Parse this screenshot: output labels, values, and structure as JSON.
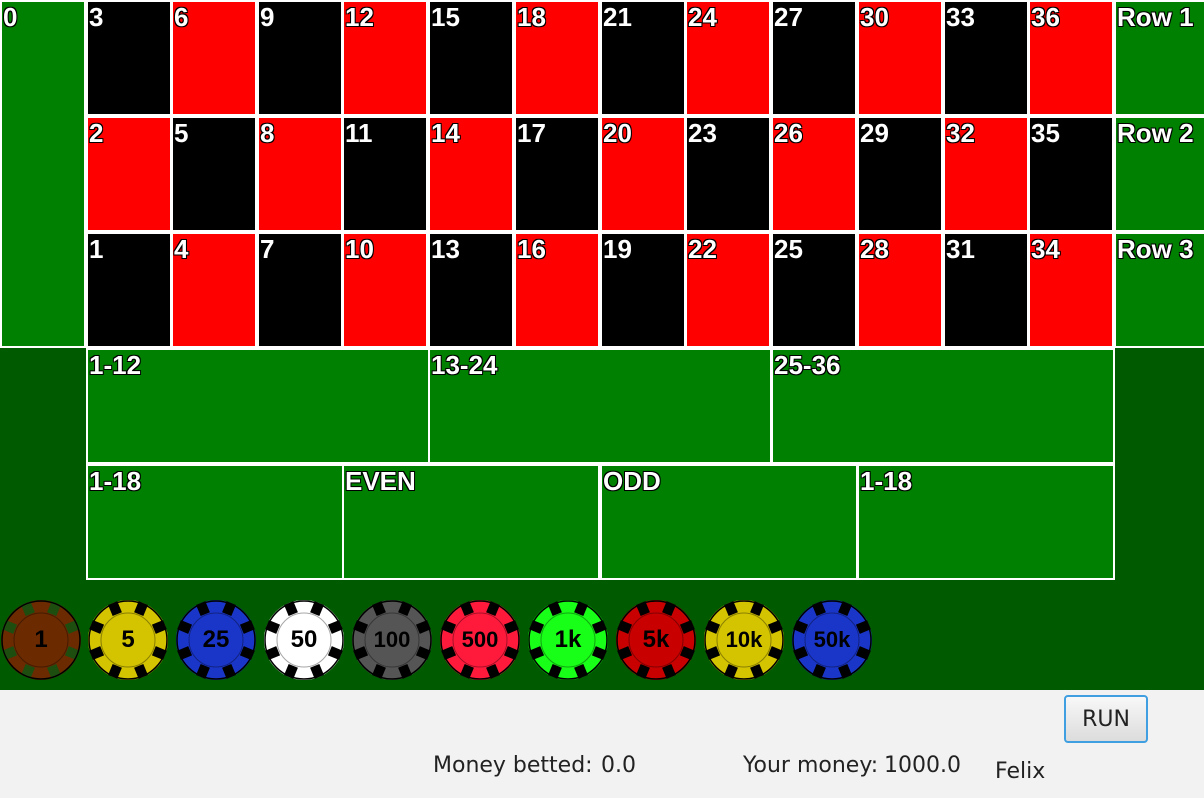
{
  "zero": {
    "label": "0"
  },
  "numbers": [
    {
      "label": "3",
      "color": "black"
    },
    {
      "label": "6",
      "color": "red"
    },
    {
      "label": "9",
      "color": "black"
    },
    {
      "label": "12",
      "color": "red"
    },
    {
      "label": "15",
      "color": "black"
    },
    {
      "label": "18",
      "color": "red"
    },
    {
      "label": "21",
      "color": "black"
    },
    {
      "label": "24",
      "color": "red"
    },
    {
      "label": "27",
      "color": "black"
    },
    {
      "label": "30",
      "color": "red"
    },
    {
      "label": "33",
      "color": "black"
    },
    {
      "label": "36",
      "color": "red"
    },
    {
      "label": "2",
      "color": "red"
    },
    {
      "label": "5",
      "color": "black"
    },
    {
      "label": "8",
      "color": "red"
    },
    {
      "label": "11",
      "color": "black"
    },
    {
      "label": "14",
      "color": "red"
    },
    {
      "label": "17",
      "color": "black"
    },
    {
      "label": "20",
      "color": "red"
    },
    {
      "label": "23",
      "color": "black"
    },
    {
      "label": "26",
      "color": "red"
    },
    {
      "label": "29",
      "color": "black"
    },
    {
      "label": "32",
      "color": "red"
    },
    {
      "label": "35",
      "color": "black"
    },
    {
      "label": "1",
      "color": "black"
    },
    {
      "label": "4",
      "color": "red"
    },
    {
      "label": "7",
      "color": "black"
    },
    {
      "label": "10",
      "color": "red"
    },
    {
      "label": "13",
      "color": "black"
    },
    {
      "label": "16",
      "color": "red"
    },
    {
      "label": "19",
      "color": "black"
    },
    {
      "label": "22",
      "color": "red"
    },
    {
      "label": "25",
      "color": "black"
    },
    {
      "label": "28",
      "color": "red"
    },
    {
      "label": "31",
      "color": "black"
    },
    {
      "label": "34",
      "color": "red"
    }
  ],
  "rows": [
    {
      "label": "Row 1"
    },
    {
      "label": "Row 2"
    },
    {
      "label": "Row 3"
    }
  ],
  "dozens": [
    {
      "label": "1-12"
    },
    {
      "label": "13-24"
    },
    {
      "label": "25-36"
    }
  ],
  "outside": [
    {
      "label": "1-18"
    },
    {
      "label": "EVEN"
    },
    {
      "label": "ODD"
    },
    {
      "label": "1-18"
    }
  ],
  "chips": [
    {
      "label": "1",
      "color": "#6b2a00",
      "stripe": "#1e4d10",
      "icon": "chip-icon"
    },
    {
      "label": "5",
      "color": "#d4c400",
      "stripe": "#000000",
      "icon": "chip-icon"
    },
    {
      "label": "25",
      "color": "#1a36c8",
      "stripe": "#000000",
      "icon": "chip-icon"
    },
    {
      "label": "50",
      "color": "#ffffff",
      "stripe": "#000000",
      "icon": "chip-icon"
    },
    {
      "label": "100",
      "color": "#555555",
      "stripe": "#000000",
      "icon": "chip-icon"
    },
    {
      "label": "500",
      "color": "#ff1a3c",
      "stripe": "#000000",
      "icon": "chip-icon"
    },
    {
      "label": "1k",
      "color": "#18ff18",
      "stripe": "#000000",
      "icon": "chip-icon"
    },
    {
      "label": "5k",
      "color": "#c80000",
      "stripe": "#000000",
      "icon": "chip-icon"
    },
    {
      "label": "10k",
      "color": "#d4c400",
      "stripe": "#000000",
      "icon": "chip-icon"
    },
    {
      "label": "50k",
      "color": "#1a36c8",
      "stripe": "#000000",
      "icon": "chip-icon"
    }
  ],
  "footer": {
    "run_label": "RUN",
    "money_betted_label": "Money betted:",
    "money_betted_value": "0.0",
    "your_money_label": "Your money:",
    "your_money_value": "1000.0",
    "player_name": "Felix"
  },
  "colors": {
    "felt": "#005a00",
    "cell_green": "#008000",
    "red": "#ff0000",
    "black": "#000000"
  }
}
